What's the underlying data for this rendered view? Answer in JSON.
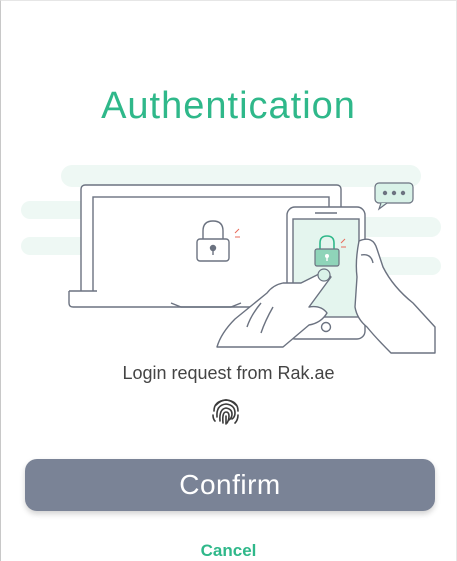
{
  "header": {
    "title": "Authentication"
  },
  "illustration": {
    "icon_laptop_lock": "lock-icon",
    "icon_phone_lock": "lock-icon",
    "icon_chat": "chat-bubble-icon"
  },
  "request": {
    "text": "Login request from Rak.ae"
  },
  "fingerprint": {
    "icon": "fingerprint-icon"
  },
  "actions": {
    "confirm_label": "Confirm",
    "cancel_label": "Cancel"
  },
  "colors": {
    "accent": "#2fb88a",
    "button": "#7a8396",
    "text": "#444444"
  }
}
